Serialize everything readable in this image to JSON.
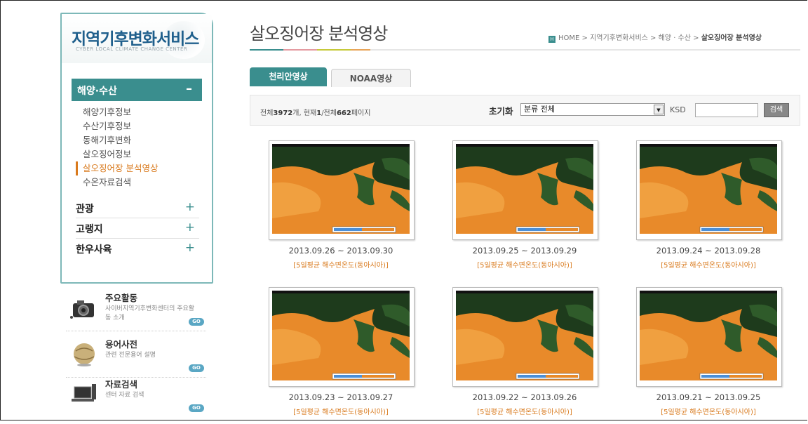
{
  "brand": {
    "title": "지역기후변화서비스",
    "subtitle": "CYBER LOCAL CLIMATE CHANGE CENTER"
  },
  "sidebar": {
    "active_category": {
      "label": "해양·수산",
      "toggle": "–"
    },
    "submenu": [
      {
        "label": "해양기후정보"
      },
      {
        "label": "수산기후정보"
      },
      {
        "label": "동해기후변화"
      },
      {
        "label": "살오징어정보"
      },
      {
        "label": "살오징어장 분석영상"
      },
      {
        "label": "수온자료검색"
      }
    ],
    "groups": [
      {
        "label": "관광",
        "toggle": "+"
      },
      {
        "label": "고랭지",
        "toggle": "+"
      },
      {
        "label": "한우사육",
        "toggle": "+"
      }
    ]
  },
  "quick_links": [
    {
      "title": "주요활동",
      "desc": "사이버지역기후변화센터의 주요활동 소개",
      "go": "GO",
      "icon": "camera-icon"
    },
    {
      "title": "용어사전",
      "desc": "관련 전문용어 설명",
      "go": "GO",
      "icon": "globe-icon"
    },
    {
      "title": "자료검색",
      "desc": "센터 자료 검색",
      "go": "GO",
      "icon": "laptop-icon"
    }
  ],
  "main": {
    "title": "살오징어장 분석영상",
    "breadcrumb": {
      "home_icon": "H",
      "path": "HOME > 지역기후변화서비스 > 해양 · 수산 > ",
      "current": "살오징어장 분석영상"
    },
    "tabs": [
      {
        "label": "천리안영상",
        "active": true
      },
      {
        "label": "NOAA영상",
        "active": false
      }
    ],
    "filter": {
      "count_prefix": "전체",
      "total": "3972",
      "count_mid": "개, 현재",
      "current_page": "1",
      "page_mid": "/전체",
      "total_pages": "662",
      "count_suffix": "페이지",
      "reset_label": "초기화",
      "category_selected": "분류 전체",
      "ksd_label": "KSD",
      "ksd_value": "",
      "search_button": "검색"
    },
    "gallery": [
      {
        "date": "2013.09.26 ~ 2013.09.30",
        "caption": "[5일평균 해수면온도(동아시아)]"
      },
      {
        "date": "2013.09.25 ~ 2013.09.29",
        "caption": "[5일평균 해수면온도(동아시아)]"
      },
      {
        "date": "2013.09.24 ~ 2013.09.28",
        "caption": "[5일평균 해수면온도(동아시아)]"
      },
      {
        "date": "2013.09.23 ~ 2013.09.27",
        "caption": "[5일평균 해수면온도(동아시아)]"
      },
      {
        "date": "2013.09.22 ~ 2013.09.26",
        "caption": "[5일평균 해수면온도(동아시아)]"
      },
      {
        "date": "2013.09.21 ~ 2013.09.25",
        "caption": "[5일평균 해수면온도(동아시아)]"
      }
    ]
  },
  "colors": {
    "accent": "#3a8e8e",
    "highlight": "#d97a1d",
    "brand": "#1f5f8c",
    "sea_warm": "#e88a2a",
    "land": "#2f5b2a"
  }
}
